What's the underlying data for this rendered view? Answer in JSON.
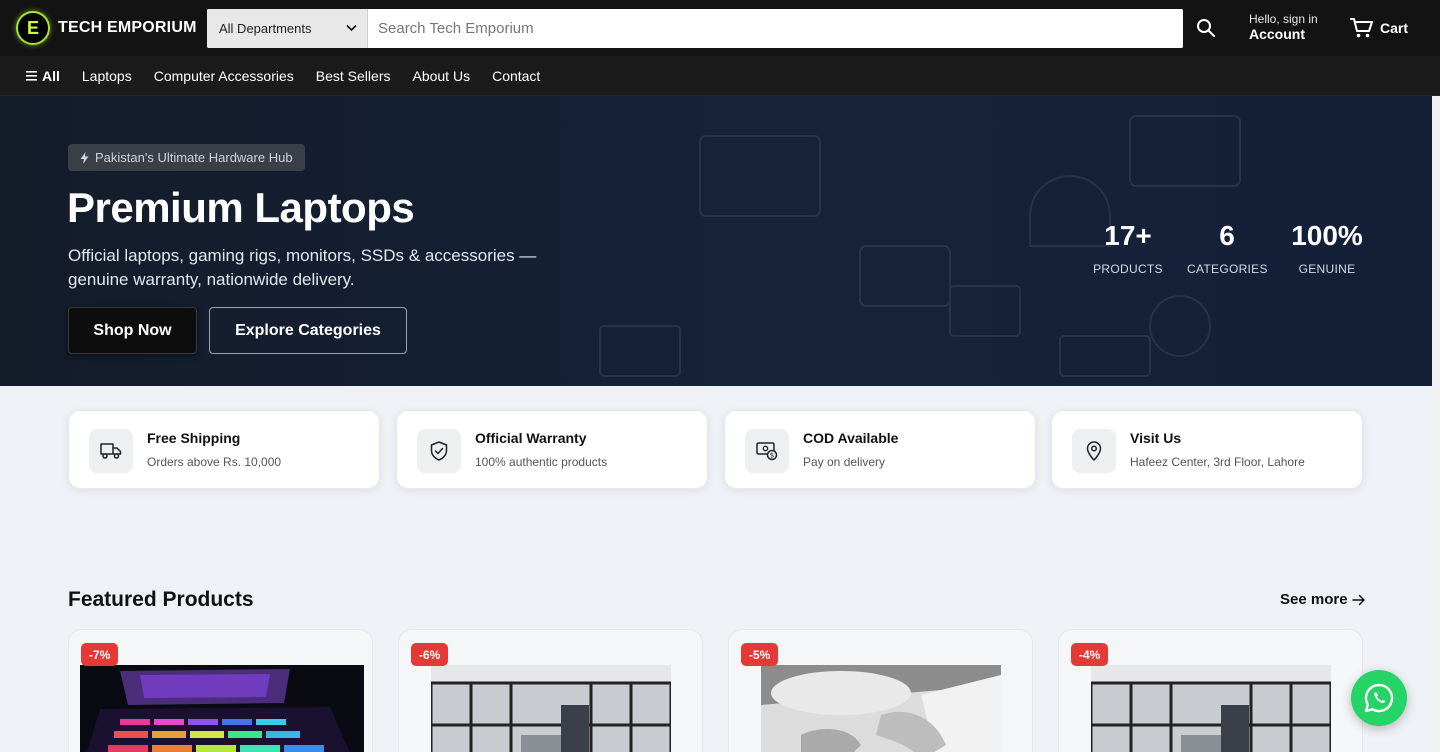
{
  "header": {
    "logo_text": "TECH EMPORIUM",
    "department_select": "All Departments",
    "search_placeholder": "Search Tech Emporium",
    "account_greeting": "Hello, sign in",
    "account_label": "Account",
    "cart_label": "Cart"
  },
  "nav": {
    "all_label": "All",
    "items": [
      "Laptops",
      "Computer Accessories",
      "Best Sellers",
      "About Us",
      "Contact"
    ]
  },
  "hero": {
    "badge": "Pakistan's Ultimate Hardware Hub",
    "title": "Premium Laptops",
    "subtitle": "Official laptops, gaming rigs, monitors, SSDs & accessories — genuine warranty, nationwide delivery.",
    "shop_button": "Shop Now",
    "explore_button": "Explore Categories",
    "stats": [
      {
        "value": "17+",
        "label": "PRODUCTS"
      },
      {
        "value": "6",
        "label": "CATEGORIES"
      },
      {
        "value": "100%",
        "label": "GENUINE"
      }
    ]
  },
  "features": [
    {
      "title": "Free Shipping",
      "subtitle": "Orders above Rs. 10,000",
      "icon": "truck-icon"
    },
    {
      "title": "Official Warranty",
      "subtitle": "100% authentic products",
      "icon": "shield-check-icon"
    },
    {
      "title": "COD Available",
      "subtitle": "Pay on delivery",
      "icon": "cash-icon"
    },
    {
      "title": "Visit Us",
      "subtitle": "Hafeez Center, 3rd Floor, Lahore",
      "icon": "map-pin-icon"
    }
  ],
  "featured": {
    "title": "Featured Products",
    "see_more": "See more",
    "products": [
      {
        "discount": "-7%"
      },
      {
        "discount": "-6%"
      },
      {
        "discount": "-5%"
      },
      {
        "discount": "-4%"
      }
    ]
  },
  "colors": {
    "topbar": "#131313",
    "navbar": "#1b1b1b",
    "hero_bg": "#16223a",
    "discount_badge": "#e53935",
    "whatsapp": "#25d366",
    "logo_accent": "#a6e22e"
  }
}
